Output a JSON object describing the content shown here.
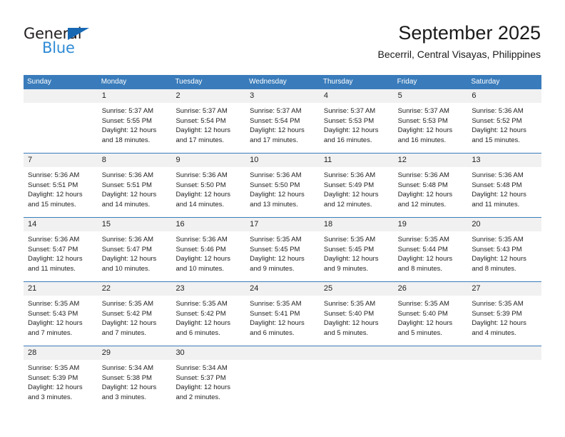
{
  "brand": {
    "name_top": "General",
    "name_bottom": "Blue",
    "triangle_color": "#1668b3",
    "blue_text_color": "#2e8bd6"
  },
  "header": {
    "title": "September 2025",
    "subtitle": "Becerril, Central Visayas, Philippines"
  },
  "theme": {
    "header_blue": "#3a7cbb",
    "daynum_band": "#f1f1f1",
    "text": "#222222"
  },
  "weekdays": [
    "Sunday",
    "Monday",
    "Tuesday",
    "Wednesday",
    "Thursday",
    "Friday",
    "Saturday"
  ],
  "weeks": [
    {
      "days": [
        {
          "num": "",
          "sunrise": "",
          "sunset": "",
          "daylight_1": "",
          "daylight_2": ""
        },
        {
          "num": "1",
          "sunrise": "Sunrise: 5:37 AM",
          "sunset": "Sunset: 5:55 PM",
          "daylight_1": "Daylight: 12 hours",
          "daylight_2": "and 18 minutes."
        },
        {
          "num": "2",
          "sunrise": "Sunrise: 5:37 AM",
          "sunset": "Sunset: 5:54 PM",
          "daylight_1": "Daylight: 12 hours",
          "daylight_2": "and 17 minutes."
        },
        {
          "num": "3",
          "sunrise": "Sunrise: 5:37 AM",
          "sunset": "Sunset: 5:54 PM",
          "daylight_1": "Daylight: 12 hours",
          "daylight_2": "and 17 minutes."
        },
        {
          "num": "4",
          "sunrise": "Sunrise: 5:37 AM",
          "sunset": "Sunset: 5:53 PM",
          "daylight_1": "Daylight: 12 hours",
          "daylight_2": "and 16 minutes."
        },
        {
          "num": "5",
          "sunrise": "Sunrise: 5:37 AM",
          "sunset": "Sunset: 5:53 PM",
          "daylight_1": "Daylight: 12 hours",
          "daylight_2": "and 16 minutes."
        },
        {
          "num": "6",
          "sunrise": "Sunrise: 5:36 AM",
          "sunset": "Sunset: 5:52 PM",
          "daylight_1": "Daylight: 12 hours",
          "daylight_2": "and 15 minutes."
        }
      ]
    },
    {
      "days": [
        {
          "num": "7",
          "sunrise": "Sunrise: 5:36 AM",
          "sunset": "Sunset: 5:51 PM",
          "daylight_1": "Daylight: 12 hours",
          "daylight_2": "and 15 minutes."
        },
        {
          "num": "8",
          "sunrise": "Sunrise: 5:36 AM",
          "sunset": "Sunset: 5:51 PM",
          "daylight_1": "Daylight: 12 hours",
          "daylight_2": "and 14 minutes."
        },
        {
          "num": "9",
          "sunrise": "Sunrise: 5:36 AM",
          "sunset": "Sunset: 5:50 PM",
          "daylight_1": "Daylight: 12 hours",
          "daylight_2": "and 14 minutes."
        },
        {
          "num": "10",
          "sunrise": "Sunrise: 5:36 AM",
          "sunset": "Sunset: 5:50 PM",
          "daylight_1": "Daylight: 12 hours",
          "daylight_2": "and 13 minutes."
        },
        {
          "num": "11",
          "sunrise": "Sunrise: 5:36 AM",
          "sunset": "Sunset: 5:49 PM",
          "daylight_1": "Daylight: 12 hours",
          "daylight_2": "and 12 minutes."
        },
        {
          "num": "12",
          "sunrise": "Sunrise: 5:36 AM",
          "sunset": "Sunset: 5:48 PM",
          "daylight_1": "Daylight: 12 hours",
          "daylight_2": "and 12 minutes."
        },
        {
          "num": "13",
          "sunrise": "Sunrise: 5:36 AM",
          "sunset": "Sunset: 5:48 PM",
          "daylight_1": "Daylight: 12 hours",
          "daylight_2": "and 11 minutes."
        }
      ]
    },
    {
      "days": [
        {
          "num": "14",
          "sunrise": "Sunrise: 5:36 AM",
          "sunset": "Sunset: 5:47 PM",
          "daylight_1": "Daylight: 12 hours",
          "daylight_2": "and 11 minutes."
        },
        {
          "num": "15",
          "sunrise": "Sunrise: 5:36 AM",
          "sunset": "Sunset: 5:47 PM",
          "daylight_1": "Daylight: 12 hours",
          "daylight_2": "and 10 minutes."
        },
        {
          "num": "16",
          "sunrise": "Sunrise: 5:36 AM",
          "sunset": "Sunset: 5:46 PM",
          "daylight_1": "Daylight: 12 hours",
          "daylight_2": "and 10 minutes."
        },
        {
          "num": "17",
          "sunrise": "Sunrise: 5:35 AM",
          "sunset": "Sunset: 5:45 PM",
          "daylight_1": "Daylight: 12 hours",
          "daylight_2": "and 9 minutes."
        },
        {
          "num": "18",
          "sunrise": "Sunrise: 5:35 AM",
          "sunset": "Sunset: 5:45 PM",
          "daylight_1": "Daylight: 12 hours",
          "daylight_2": "and 9 minutes."
        },
        {
          "num": "19",
          "sunrise": "Sunrise: 5:35 AM",
          "sunset": "Sunset: 5:44 PM",
          "daylight_1": "Daylight: 12 hours",
          "daylight_2": "and 8 minutes."
        },
        {
          "num": "20",
          "sunrise": "Sunrise: 5:35 AM",
          "sunset": "Sunset: 5:43 PM",
          "daylight_1": "Daylight: 12 hours",
          "daylight_2": "and 8 minutes."
        }
      ]
    },
    {
      "days": [
        {
          "num": "21",
          "sunrise": "Sunrise: 5:35 AM",
          "sunset": "Sunset: 5:43 PM",
          "daylight_1": "Daylight: 12 hours",
          "daylight_2": "and 7 minutes."
        },
        {
          "num": "22",
          "sunrise": "Sunrise: 5:35 AM",
          "sunset": "Sunset: 5:42 PM",
          "daylight_1": "Daylight: 12 hours",
          "daylight_2": "and 7 minutes."
        },
        {
          "num": "23",
          "sunrise": "Sunrise: 5:35 AM",
          "sunset": "Sunset: 5:42 PM",
          "daylight_1": "Daylight: 12 hours",
          "daylight_2": "and 6 minutes."
        },
        {
          "num": "24",
          "sunrise": "Sunrise: 5:35 AM",
          "sunset": "Sunset: 5:41 PM",
          "daylight_1": "Daylight: 12 hours",
          "daylight_2": "and 6 minutes."
        },
        {
          "num": "25",
          "sunrise": "Sunrise: 5:35 AM",
          "sunset": "Sunset: 5:40 PM",
          "daylight_1": "Daylight: 12 hours",
          "daylight_2": "and 5 minutes."
        },
        {
          "num": "26",
          "sunrise": "Sunrise: 5:35 AM",
          "sunset": "Sunset: 5:40 PM",
          "daylight_1": "Daylight: 12 hours",
          "daylight_2": "and 5 minutes."
        },
        {
          "num": "27",
          "sunrise": "Sunrise: 5:35 AM",
          "sunset": "Sunset: 5:39 PM",
          "daylight_1": "Daylight: 12 hours",
          "daylight_2": "and 4 minutes."
        }
      ]
    },
    {
      "days": [
        {
          "num": "28",
          "sunrise": "Sunrise: 5:35 AM",
          "sunset": "Sunset: 5:39 PM",
          "daylight_1": "Daylight: 12 hours",
          "daylight_2": "and 3 minutes."
        },
        {
          "num": "29",
          "sunrise": "Sunrise: 5:34 AM",
          "sunset": "Sunset: 5:38 PM",
          "daylight_1": "Daylight: 12 hours",
          "daylight_2": "and 3 minutes."
        },
        {
          "num": "30",
          "sunrise": "Sunrise: 5:34 AM",
          "sunset": "Sunset: 5:37 PM",
          "daylight_1": "Daylight: 12 hours",
          "daylight_2": "and 2 minutes."
        },
        {
          "num": "",
          "sunrise": "",
          "sunset": "",
          "daylight_1": "",
          "daylight_2": ""
        },
        {
          "num": "",
          "sunrise": "",
          "sunset": "",
          "daylight_1": "",
          "daylight_2": ""
        },
        {
          "num": "",
          "sunrise": "",
          "sunset": "",
          "daylight_1": "",
          "daylight_2": ""
        },
        {
          "num": "",
          "sunrise": "",
          "sunset": "",
          "daylight_1": "",
          "daylight_2": ""
        }
      ]
    }
  ]
}
